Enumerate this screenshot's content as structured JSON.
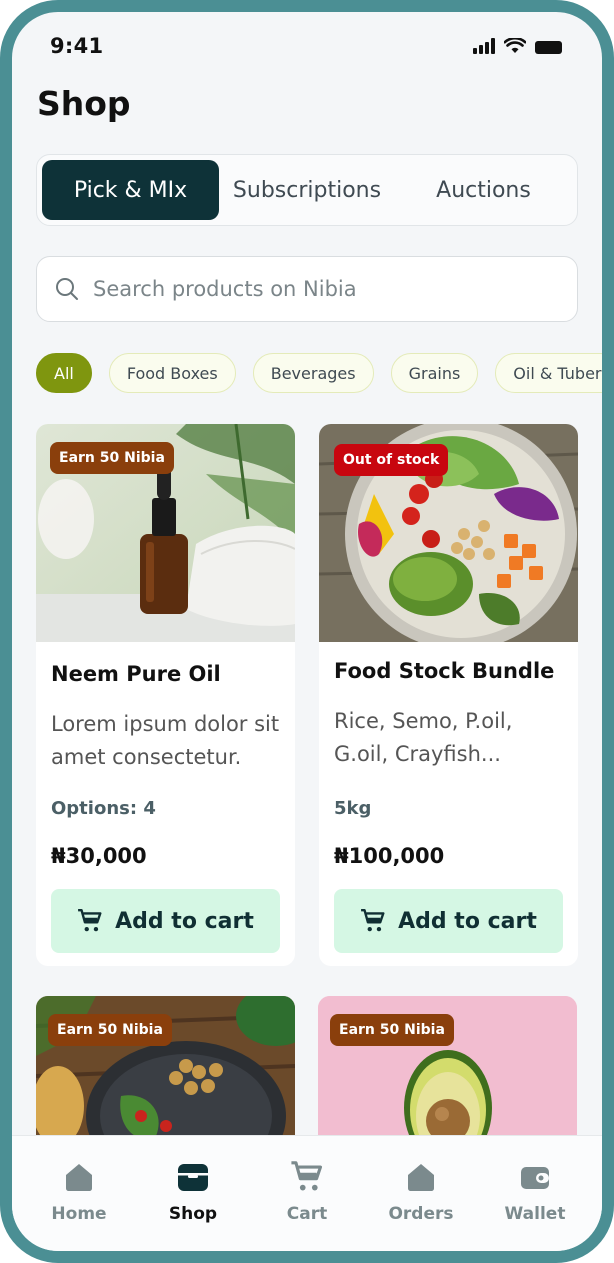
{
  "status_bar": {
    "time": "9:41"
  },
  "page": {
    "title": "Shop"
  },
  "tabs": [
    {
      "label": "Pick & MIx",
      "active": true
    },
    {
      "label": "Subscriptions",
      "active": false
    },
    {
      "label": "Auctions",
      "active": false
    }
  ],
  "search": {
    "placeholder": "Search products on Nibia",
    "value": ""
  },
  "chips": [
    "All",
    "Food Boxes",
    "Beverages",
    "Grains",
    "Oil & Tuber"
  ],
  "products": [
    {
      "badge": "Earn 50 Nibia",
      "title": "Neem Pure Oil",
      "description": "Lorem ipsum dolor sit amet consectetur.",
      "meta": "Options: 4",
      "price": "₦30,000",
      "button": "Add to cart"
    },
    {
      "badge": "Out of stock",
      "title": "Food Stock Bundle",
      "description": "Rice, Semo, P.oil, G.oil, Crayfish...",
      "meta": "5kg",
      "price": "₦100,000",
      "button": "Add to cart"
    },
    {
      "badge": "Earn 50 Nibia"
    },
    {
      "badge": "Earn 50 Nibia"
    }
  ],
  "bottom_nav": [
    {
      "label": "Home",
      "icon": "home-icon",
      "active": false
    },
    {
      "label": "Shop",
      "icon": "shop-icon",
      "active": true
    },
    {
      "label": "Cart",
      "icon": "cart-icon",
      "active": false
    },
    {
      "label": "Orders",
      "icon": "orders-icon",
      "active": false
    },
    {
      "label": "Wallet",
      "icon": "wallet-icon",
      "active": false
    }
  ],
  "colors": {
    "frame": "#4b8f94",
    "active_tab": "#0e3238",
    "active_chip": "#7f960f",
    "earn_badge": "#8a3f0c",
    "out_of_stock_badge": "#c8060f",
    "cart_button": "#d5f7e4"
  }
}
